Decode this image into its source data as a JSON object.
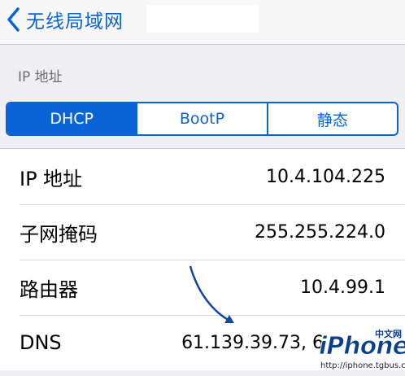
{
  "navbar": {
    "back_label": "无线局域网"
  },
  "section_header": "IP 地址",
  "segmented": [
    {
      "label": "DHCP",
      "selected": true
    },
    {
      "label": "BootP",
      "selected": false
    },
    {
      "label": "静态",
      "selected": false
    }
  ],
  "rows": [
    {
      "label": "IP 地址",
      "value": "10.4.104.225"
    },
    {
      "label": "子网掩码",
      "value": "255.255.224.0"
    },
    {
      "label": "路由器",
      "value": "10.4.99.1"
    },
    {
      "label": "DNS",
      "value": "61.139.39.73, 6"
    }
  ],
  "watermark": {
    "logo": "iPhone",
    "cn": "中文网",
    "url": "http://iphone.tgbus.com/"
  },
  "colors": {
    "accent": "#0a64d6",
    "background": "#efeff4",
    "cell": "#ffffff"
  }
}
